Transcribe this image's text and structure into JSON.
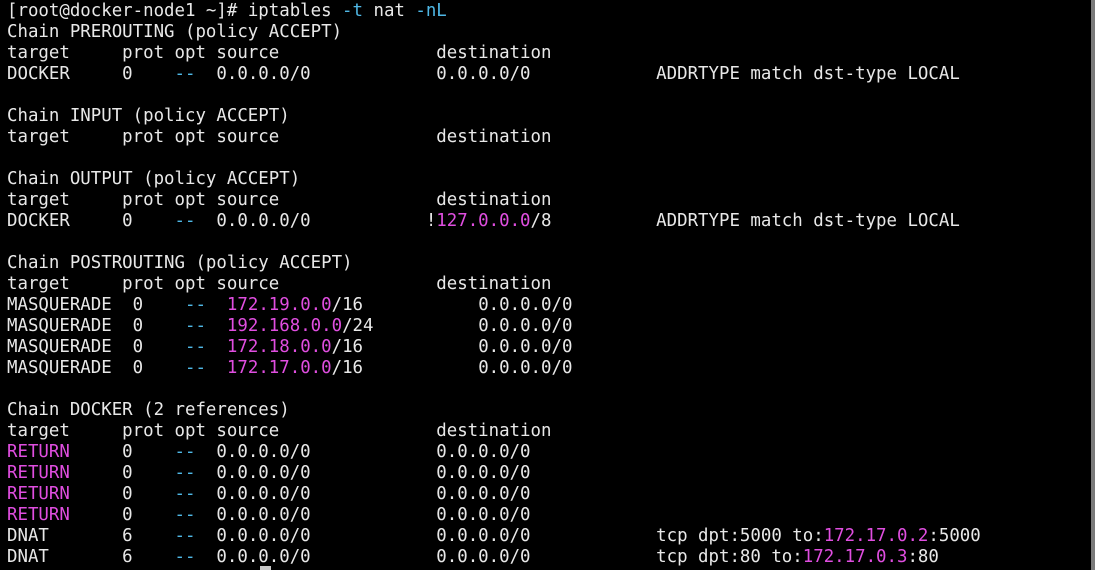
{
  "colors": {
    "background": "#000000",
    "text": "#e8e8e8",
    "highlight_ip": "#e04ee0",
    "option_dash": "#4fb8e6"
  },
  "terminal": {
    "prompt": "[root@docker-node1 ~]# ",
    "cmd_name": "iptables ",
    "flag_t": "-t",
    "cmd_table": " nat ",
    "flag_nl": "-nL",
    "header_row": "target     prot opt source               destination",
    "prerouting": {
      "title": "Chain PREROUTING (policy ACCEPT)",
      "row1": {
        "pre": "DOCKER     0    ",
        "opt": "--",
        "post": "  0.0.0.0/0            0.0.0.0/0            ADDRTYPE match dst-type LOCAL"
      }
    },
    "input": {
      "title": "Chain INPUT (policy ACCEPT)"
    },
    "output": {
      "title": "Chain OUTPUT (policy ACCEPT)",
      "row1": {
        "pre": "DOCKER     0    ",
        "opt": "--",
        "mid": "  0.0.0.0/0           !",
        "ip": "127.0.0.0",
        "post": "/8          ADDRTYPE match dst-type LOCAL"
      }
    },
    "postrouting": {
      "title": "Chain POSTROUTING (policy ACCEPT)",
      "rows": [
        {
          "pre": "MASQUERADE  0    ",
          "opt": "--",
          "mid": "  ",
          "ip": "172.19.0.0",
          "post": "/16           0.0.0.0/0"
        },
        {
          "pre": "MASQUERADE  0    ",
          "opt": "--",
          "mid": "  ",
          "ip": "192.168.0.0",
          "post": "/24          0.0.0.0/0"
        },
        {
          "pre": "MASQUERADE  0    ",
          "opt": "--",
          "mid": "  ",
          "ip": "172.18.0.0",
          "post": "/16           0.0.0.0/0"
        },
        {
          "pre": "MASQUERADE  0    ",
          "opt": "--",
          "mid": "  ",
          "ip": "172.17.0.0",
          "post": "/16           0.0.0.0/0"
        }
      ]
    },
    "docker": {
      "title": "Chain DOCKER (2 references)",
      "return_rows": [
        {
          "target": "RETURN",
          "pre": "     0    ",
          "opt": "--",
          "post": "  0.0.0.0/0            0.0.0.0/0"
        },
        {
          "target": "RETURN",
          "pre": "     0    ",
          "opt": "--",
          "post": "  0.0.0.0/0            0.0.0.0/0"
        },
        {
          "target": "RETURN",
          "pre": "     0    ",
          "opt": "--",
          "post": "  0.0.0.0/0            0.0.0.0/0"
        },
        {
          "target": "RETURN",
          "pre": "     0    ",
          "opt": "--",
          "post": "  0.0.0.0/0            0.0.0.0/0"
        }
      ],
      "dnat_rows": [
        {
          "pre": "DNAT       6    ",
          "opt": "--",
          "mid": "  0.0.0.0/0            0.0.0.0/0            tcp dpt:5000 to:",
          "ip": "172.17.0.2",
          "post": ":5000"
        },
        {
          "pre": "DNAT       6    ",
          "opt": "--",
          "mid": "  0.0.0.0/0            0.0.0.0/0            tcp dpt:80 to:",
          "ip": "172.17.0.3",
          "post": ":80"
        }
      ]
    }
  }
}
